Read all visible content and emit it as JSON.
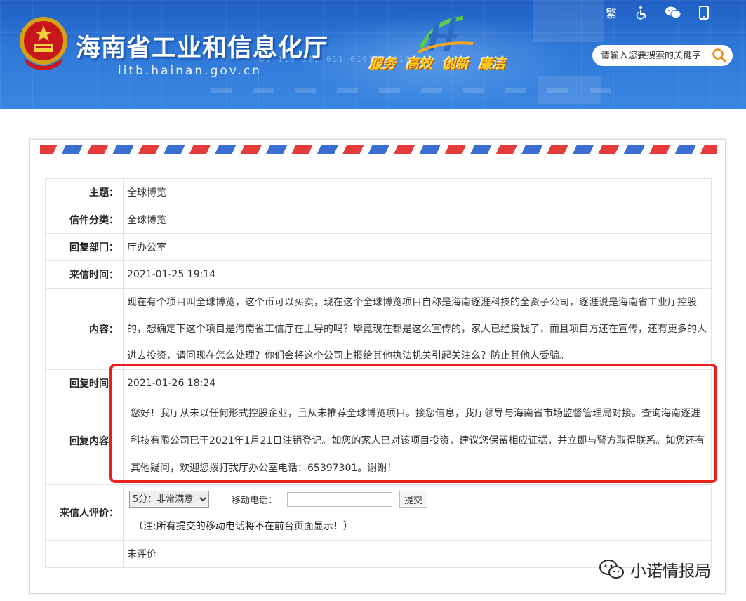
{
  "header": {
    "site_title": "海南省工业和信息化厅",
    "site_url": "iitb.hainan.gov.cn",
    "binary_text": "01 110 101 011 0101101010",
    "slogan": [
      "服务",
      "高效",
      "创新",
      "廉洁"
    ],
    "icons": [
      {
        "name": "traditional-chinese-toggle",
        "glyph": "繁"
      },
      {
        "name": "accessibility-icon",
        "glyph": "♿"
      },
      {
        "name": "wechat-icon",
        "glyph": "💬"
      },
      {
        "name": "mobile-icon",
        "glyph": "📱"
      }
    ],
    "search_placeholder": "请输入您要搜索的关键字"
  },
  "letter": {
    "subject_label": "主题：",
    "subject": "全球博览",
    "category_label": "信件分类：",
    "category": "全球博览",
    "dept_label": "回复部门：",
    "dept": "厅办公室",
    "time_label": "来信时间：",
    "time": "2021-01-25 19:14",
    "content_label": "内容：",
    "content": "现在有个项目叫全球博览，这个币可以买卖，现在这个全球博览项目自称是海南逐涯科技的全资子公司，逐涯说是海南省工业厅控股的，想确定下这个项目是海南省工信厅在主导的吗？毕竟现在都是这么宣传的，家人已经投钱了，而且项目方还在宣传，还有更多的人进去投资，请问现在怎么处理？你们会将这个公司上报给其他执法机关引起关注么？防止其他人受骗。",
    "reply_time_label": "回复时间：",
    "reply_time": "2021-01-26 18:24",
    "reply_label": "回复内容：",
    "reply": "您好！我厅从未以任何形式控股企业，且从未推荐全球博览项目。接您信息，我厅领导与海南省市场监督管理局对接。查询海南逐涯科技有限公司已于2021年1月21日注销登记。如您的家人已对该项目投资，建议您保留相应证据，并立即与警方取得联系。如您还有其他疑问，欢迎您拨打我厅办公室电话：65397301。谢谢！",
    "eval_label": "来信人评价：",
    "rating_selected": "5分：非常满意",
    "mobile_label": "移动电话：",
    "submit_label": "提交",
    "note": "（注:所有提交的移动电话将不在前台页面显示！）",
    "eval_status": "未评价"
  },
  "watermark": "小诺情报局",
  "colors": {
    "header_blue": "#2f78d8",
    "slogan_yellow": "#ffcf1a",
    "highlight_red": "#e8221b",
    "stripe_red": "#e53b3b",
    "stripe_blue": "#3a6fd1"
  }
}
